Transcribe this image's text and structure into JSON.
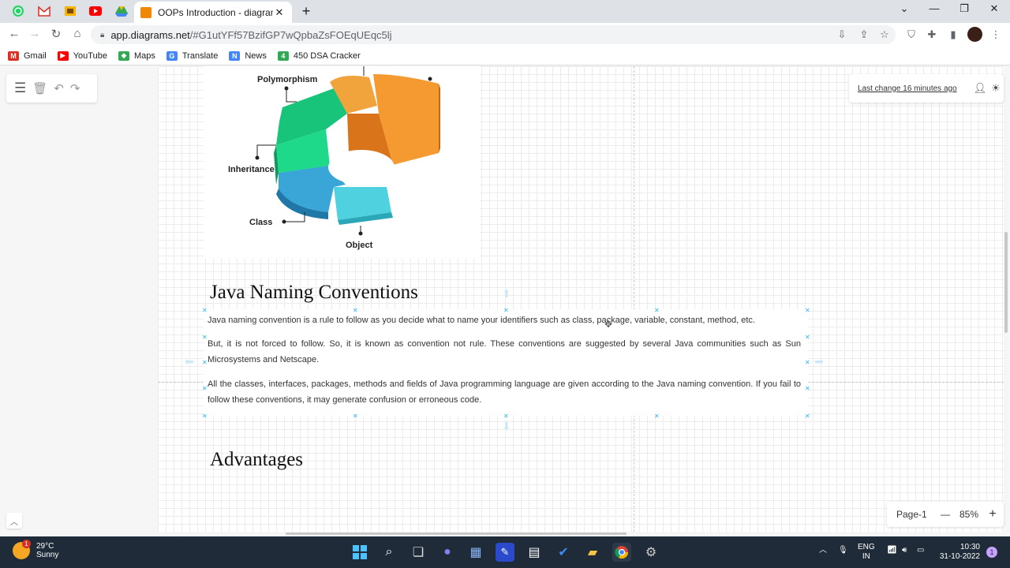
{
  "browser": {
    "tab_title": "OOPs Introduction - diagrams.ne",
    "tab_close": "✕",
    "new_tab": "+",
    "url_host": "app.diagrams.net",
    "url_rest": "/#G1utYFf57BzifGP7wQpbaZsFOEqUEqc5lj",
    "bookmarks": [
      {
        "label": "Gmail",
        "color": "#d93025",
        "icon": "M"
      },
      {
        "label": "YouTube",
        "color": "#ff0000",
        "icon": "▶"
      },
      {
        "label": "Maps",
        "color": "#34a853",
        "icon": "◆"
      },
      {
        "label": "Translate",
        "color": "#4285f4",
        "icon": "G"
      },
      {
        "label": "News",
        "color": "#4285f4",
        "icon": "N"
      },
      {
        "label": "450 DSA Cracker",
        "color": "#34a853",
        "icon": "4"
      }
    ]
  },
  "app": {
    "last_change": "Last change 16 minutes ago",
    "page_label": "Page-1",
    "zoom_level": "85%",
    "zoom_minus": "—",
    "zoom_plus": "+"
  },
  "diagram": {
    "labels": {
      "polymorphism": "Polymorphism",
      "inheritance": "Inheritance",
      "class": "Class",
      "object": "Object"
    },
    "heading1": "Java Naming Conventions",
    "paragraphs": [
      "Java naming convention is a rule to follow as you decide what to name your identifiers such as class, package, variable, constant, method, etc.",
      "But, it is not forced to follow. So, it is known as convention not rule. These conventions are suggested by several Java communities such as Sun Microsystems and Netscape.",
      "All the classes, interfaces, packages, methods and fields of Java programming language are given according to the Java naming convention. If you fail to follow these conventions, it may generate confusion or erroneous code."
    ],
    "heading2": "Advantages"
  },
  "taskbar": {
    "temperature": "29°C",
    "weather": "Sunny",
    "weather_badge": "1",
    "lang1": "ENG",
    "lang2": "IN",
    "time": "10:30",
    "date": "31-10-2022",
    "notif_badge": "1"
  }
}
